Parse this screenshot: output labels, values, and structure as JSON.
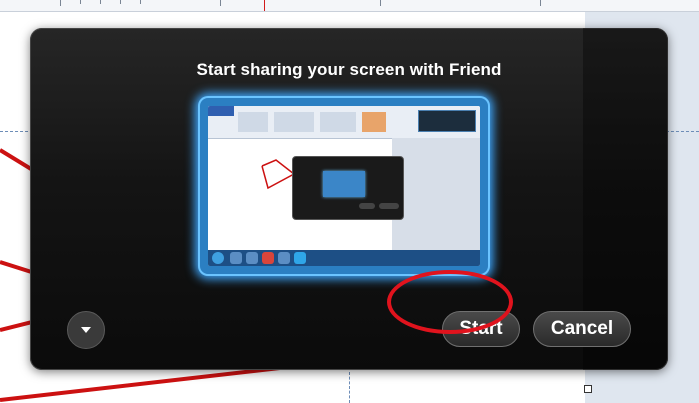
{
  "dialog": {
    "title": "Start sharing your screen with Friend",
    "start_label": "Start",
    "cancel_label": "Cancel",
    "options_icon": "chevron-down-icon"
  },
  "colors": {
    "dialog_bg": "#111111",
    "preview_glow": "#3fa8ff",
    "highlight_ring": "#e0131d",
    "button_text": "#ffffff"
  }
}
